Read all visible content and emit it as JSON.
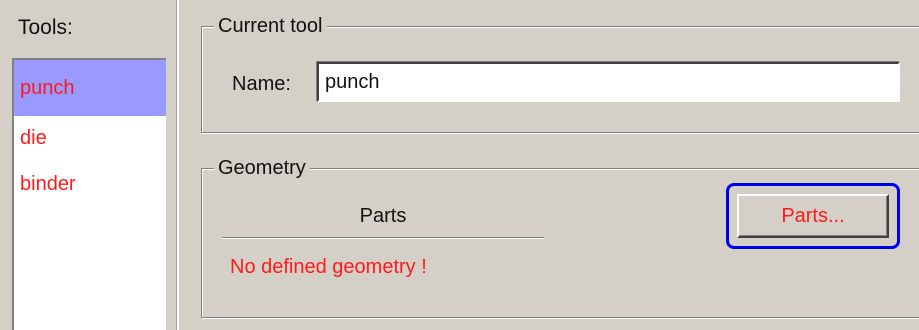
{
  "tools": {
    "label": "Tools:",
    "items": [
      {
        "label": "punch",
        "selected": true
      },
      {
        "label": "die",
        "selected": false
      },
      {
        "label": "binder",
        "selected": false
      }
    ]
  },
  "current_tool": {
    "legend": "Current tool",
    "name_label": "Name:",
    "name_value": "punch"
  },
  "geometry": {
    "legend": "Geometry",
    "parts_header": "Parts",
    "empty_message": "No defined geometry !",
    "parts_button_label": "Parts..."
  },
  "colors": {
    "selection": "#9999ff",
    "tool_text": "#ff1a1a",
    "highlight": "#0000ee",
    "background": "#d4d0c8"
  }
}
